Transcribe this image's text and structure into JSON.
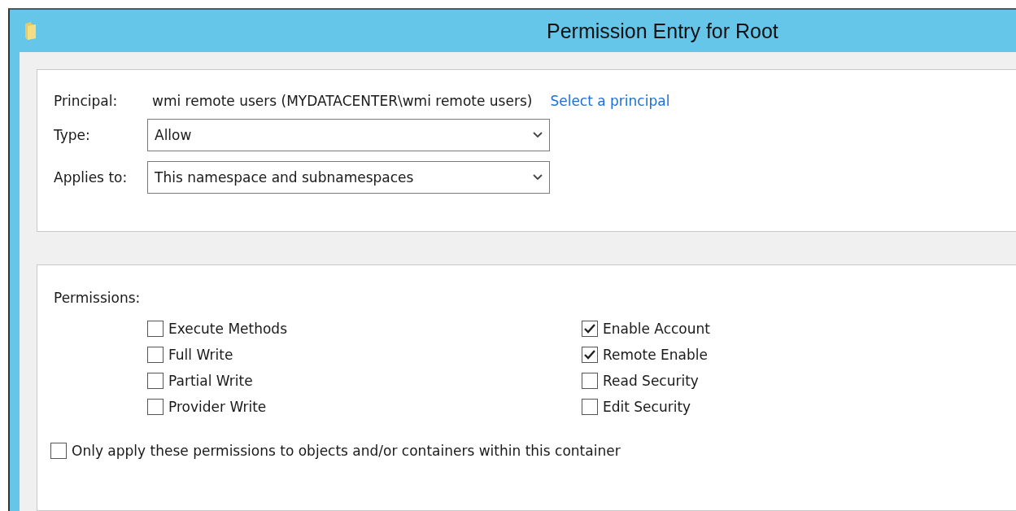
{
  "window": {
    "title": "Permission Entry for Root"
  },
  "principal": {
    "label": "Principal:",
    "value": "wmi remote users (MYDATACENTER\\wmi remote users)",
    "link": "Select a principal"
  },
  "fields": [
    {
      "label": "Type:",
      "value": "Allow"
    },
    {
      "label": "Applies to:",
      "value": "This namespace and subnamespaces"
    }
  ],
  "permissions": {
    "label": "Permissions:",
    "columns": [
      [
        {
          "label": "Execute Methods",
          "checked": false
        },
        {
          "label": "Full Write",
          "checked": false
        },
        {
          "label": "Partial Write",
          "checked": false
        },
        {
          "label": "Provider Write",
          "checked": false
        }
      ],
      [
        {
          "label": "Enable Account",
          "checked": true
        },
        {
          "label": "Remote Enable",
          "checked": true
        },
        {
          "label": "Read Security",
          "checked": false
        },
        {
          "label": "Edit Security",
          "checked": false
        }
      ]
    ]
  },
  "only_apply": {
    "label": "Only apply these permissions to objects and/or containers within this container",
    "checked": false
  }
}
